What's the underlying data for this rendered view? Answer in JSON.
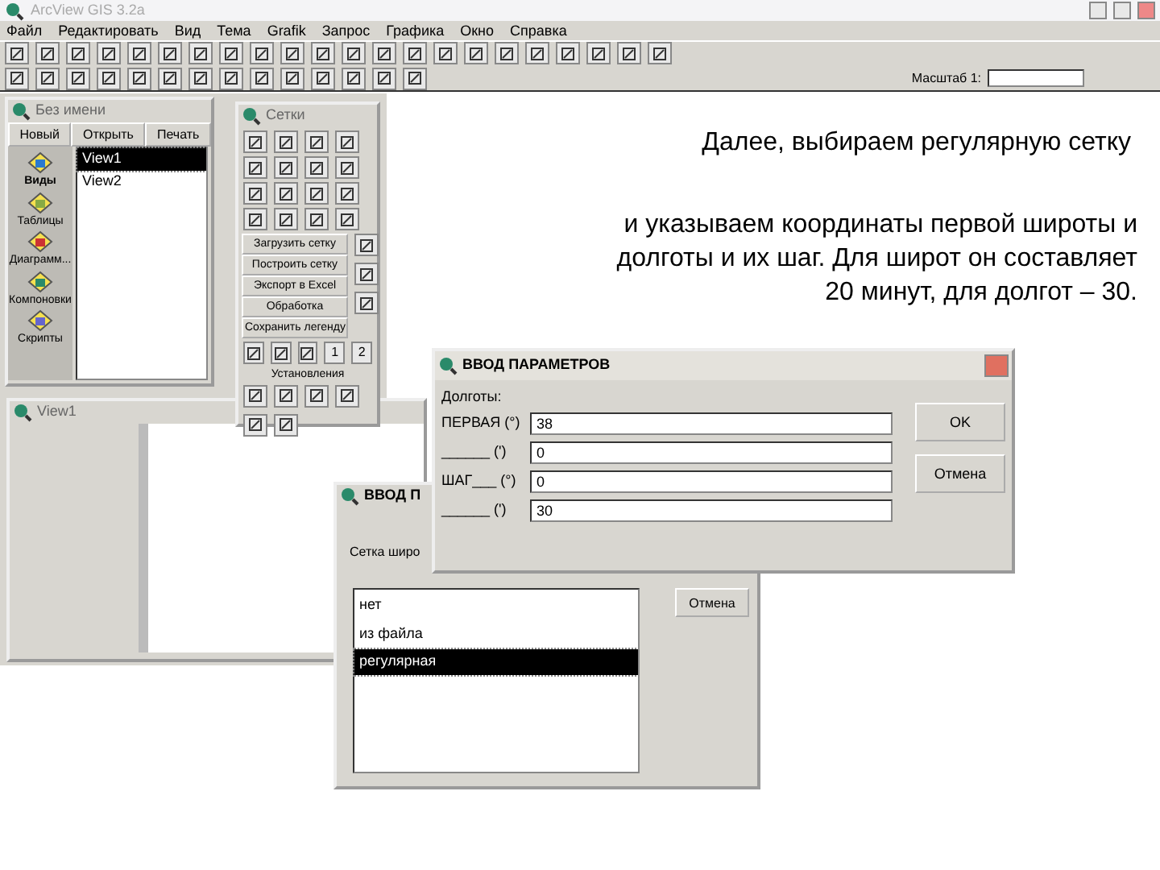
{
  "app": {
    "title": "ArcView GIS 3.2a",
    "menu": [
      "Файл",
      "Редактировать",
      "Вид",
      "Тема",
      "Grafik",
      "Запрос",
      "Графика",
      "Окно",
      "Справка"
    ],
    "scale_label": "Масштаб 1:"
  },
  "project_window": {
    "title": "Без имени",
    "buttons": [
      "Новый",
      "Открыть",
      "Печать"
    ],
    "doc_types": [
      {
        "label": "Виды",
        "selected": true
      },
      {
        "label": "Таблицы",
        "selected": false
      },
      {
        "label": "Диаграмм...",
        "selected": false
      },
      {
        "label": "Компоновки",
        "selected": false
      },
      {
        "label": "Скрипты",
        "selected": false
      }
    ],
    "items": [
      {
        "label": "View1",
        "selected": true
      },
      {
        "label": "View2",
        "selected": false
      }
    ]
  },
  "tool_window": {
    "title": "Сетки",
    "buttons": [
      "Загрузить сетку",
      "Построить сетку",
      "Экспорт в Excel",
      "Обработка",
      "Сохранить легенду"
    ],
    "side_keys": [
      "1",
      "2"
    ],
    "section_label": "Установления"
  },
  "view_window": {
    "title": "View1"
  },
  "slide_text": [
    {
      "text": "Далее, выбираем регулярную сетку"
    },
    {
      "text": "и указываем координаты первой широты и"
    },
    {
      "text": "долготы и их шаг. Для широт он составляет"
    },
    {
      "text": "20 минут, для долгот – 30."
    }
  ],
  "latitude_dialog": {
    "title": "ВВОД П",
    "label": "Сетка широ",
    "options": [
      {
        "label": "нет",
        "selected": false
      },
      {
        "label": "из файла",
        "selected": false
      },
      {
        "label": "регулярная",
        "selected": true
      }
    ],
    "button": "Отмена"
  },
  "longitude_dialog": {
    "title": "ВВОД ПАРАМЕТРОВ",
    "group_label": "Долготы:",
    "fields": [
      {
        "label": "ПЕРВАЯ (°)",
        "value": "38"
      },
      {
        "label": "______ (')",
        "value": "0"
      },
      {
        "label": "ШАГ___ (°)",
        "value": "0"
      },
      {
        "label": "______ (')",
        "value": "30"
      }
    ],
    "buttons": [
      "OK",
      "Отмена"
    ]
  }
}
